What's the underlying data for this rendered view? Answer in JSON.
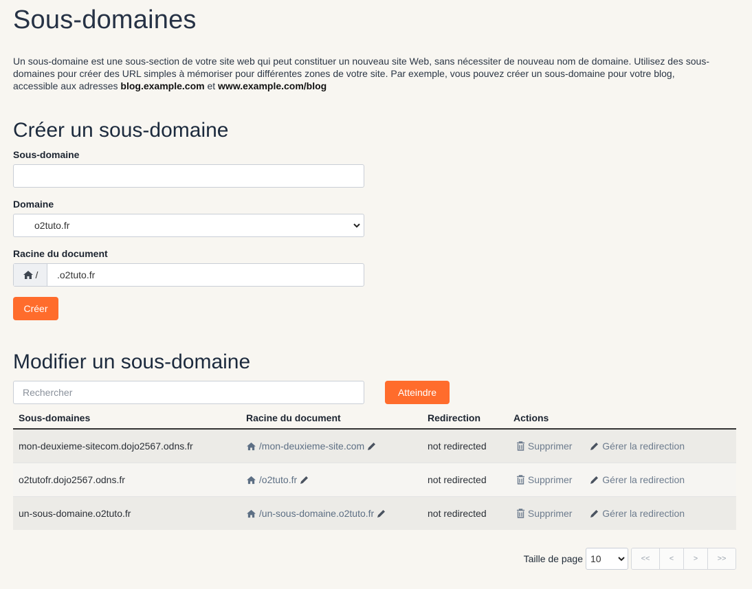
{
  "page": {
    "title": "Sous-domaines",
    "intro_part1": "Un sous-domaine est une sous-section de votre site web qui peut constituer un nouveau site Web, sans nécessiter de nouveau nom de domaine. Utilisez des sous-domaines pour créer des URL simples à mémoriser pour différentes zones de votre site. Par exemple, vous pouvez créer un sous-domaine pour votre blog, accessible aux adresses ",
    "intro_bold1": "blog.example.com",
    "intro_and": " et ",
    "intro_bold2": "www.example.com/blog"
  },
  "create": {
    "heading": "Créer un sous-domaine",
    "subdomain_label": "Sous-domaine",
    "subdomain_value": "",
    "domain_label": "Domaine",
    "domain_selected": "o2tuto.fr",
    "docroot_label": "Racine du document",
    "docroot_prefix": "/",
    "docroot_value": ".o2tuto.fr",
    "submit_label": "Créer"
  },
  "modify": {
    "heading": "Modifier un sous-domaine",
    "search_placeholder": "Rechercher",
    "go_label": "Atteindre",
    "columns": [
      "Sous-domaines",
      "Racine du document",
      "Redirection",
      "Actions"
    ],
    "rows": [
      {
        "subdomain": "mon-deuxieme-sitecom.dojo2567.odns.fr",
        "docroot": "/mon-deuxieme-site.com",
        "redirection": "not redirected",
        "delete": "Supprimer",
        "manage": "Gérer la redirection"
      },
      {
        "subdomain": "o2tutofr.dojo2567.odns.fr",
        "docroot": "/o2tuto.fr",
        "redirection": "not redirected",
        "delete": "Supprimer",
        "manage": "Gérer la redirection"
      },
      {
        "subdomain": "un-sous-domaine.o2tuto.fr",
        "docroot": "/un-sous-domaine.o2tuto.fr",
        "redirection": "not redirected",
        "delete": "Supprimer",
        "manage": "Gérer la redirection"
      }
    ]
  },
  "pager": {
    "page_size_label": "Taille de page",
    "page_size": "10",
    "first": "<<",
    "prev": "<",
    "next": ">",
    "last": ">>"
  },
  "icons": {
    "home": "home-icon",
    "edit": "pencil-icon",
    "delete": "trash-icon",
    "dropdown": "chevron-down-icon"
  },
  "colors": {
    "accent": "#ff6c2c",
    "link": "#5d6f84",
    "background": "#f8f6f1"
  }
}
